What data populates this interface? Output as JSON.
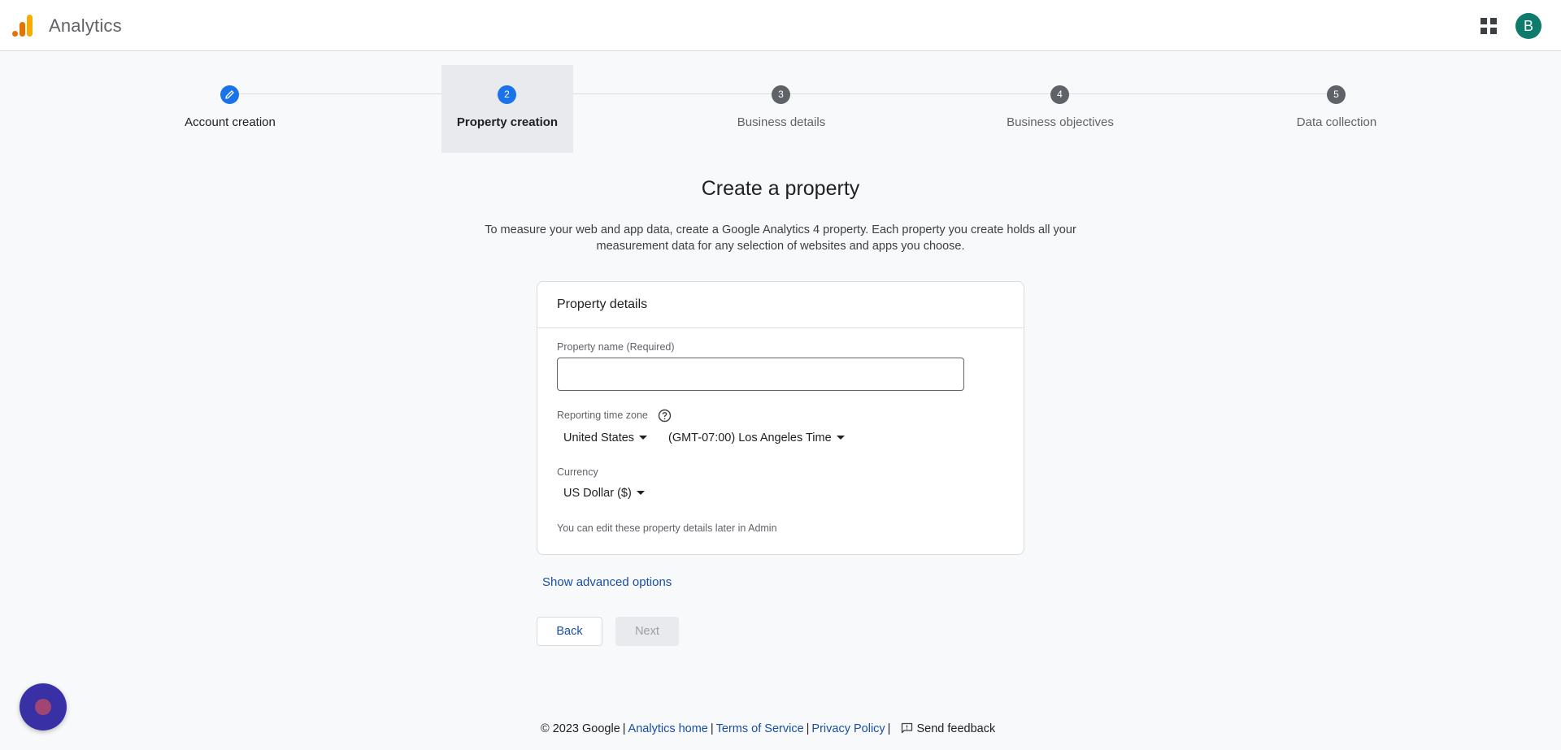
{
  "header": {
    "app_title": "Analytics",
    "avatar_initial": "B",
    "apps_icon": "apps-grid-icon",
    "logo_icon": "analytics-logo-icon",
    "colors": {
      "avatar": "#0f7b6c",
      "logo_orange": "#f9ab00",
      "logo_dark": "#e37400"
    }
  },
  "stepper": {
    "steps": [
      {
        "number": "",
        "label": "Account creation",
        "state": "completed",
        "icon": "edit-pencil-icon"
      },
      {
        "number": "2",
        "label": "Property creation",
        "state": "active"
      },
      {
        "number": "3",
        "label": "Business details",
        "state": "upcoming"
      },
      {
        "number": "4",
        "label": "Business objectives",
        "state": "upcoming"
      },
      {
        "number": "5",
        "label": "Data collection",
        "state": "upcoming"
      }
    ]
  },
  "main": {
    "title": "Create a property",
    "description_line1": "To measure your web and app data, create a Google Analytics 4 property. Each property you create holds all your",
    "description_line2": "measurement data for any selection of websites and apps you choose."
  },
  "card": {
    "header": "Property details",
    "property_name_label": "Property name (Required)",
    "property_name_value": "",
    "timezone_label": "Reporting time zone",
    "timezone_help_icon": "help-circle-icon",
    "country_value": "United States",
    "timezone_value": "(GMT-07:00) Los Angeles Time",
    "currency_label": "Currency",
    "currency_value": "US Dollar ($)",
    "note": "You can edit these property details later in Admin"
  },
  "actions": {
    "advanced_link": "Show advanced options",
    "back_label": "Back",
    "next_label": "Next",
    "next_disabled": true
  },
  "footer": {
    "copyright": "© 2023 Google",
    "analytics_home": "Analytics home",
    "terms": "Terms of Service",
    "privacy": "Privacy Policy",
    "feedback": "Send feedback",
    "feedback_icon": "feedback-icon"
  },
  "colors": {
    "primary_blue": "#1a73e8",
    "link_blue": "#174ea6",
    "fab": "#3a30a6"
  }
}
